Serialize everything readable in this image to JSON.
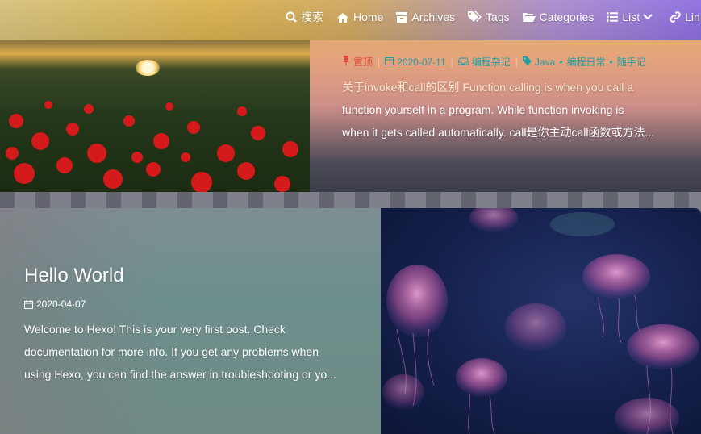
{
  "nav": {
    "items": [
      {
        "label": "搜索",
        "icon": "search-icon"
      },
      {
        "label": "Home",
        "icon": "home-icon"
      },
      {
        "label": "Archives",
        "icon": "archive-icon"
      },
      {
        "label": "Tags",
        "icon": "tags-icon"
      },
      {
        "label": "Categories",
        "icon": "folder-open-icon"
      },
      {
        "label": "List",
        "icon": "list-icon"
      },
      {
        "label": "Lin",
        "icon": "link-icon"
      }
    ]
  },
  "featured_post": {
    "sticky_label": "置顶",
    "date": "2020-07-11",
    "category": "编程杂记",
    "tags": [
      "Java",
      "编程日常",
      "随手记"
    ],
    "excerpt_lines": [
      "关于invoke和call的区别 Function calling is when you call a",
      "function yourself in a program. While function invoking is",
      "when it gets called automatically. call是你主动call函数或方法..."
    ]
  },
  "second_post": {
    "title": "Hello World",
    "date": "2020-04-07",
    "excerpt_lines": [
      "Welcome to Hexo! This is your very first post. Check",
      "documentation for more info. If you get any problems when",
      "using Hexo, you can find the answer in troubleshooting or yo..."
    ]
  },
  "colors": {
    "sticky": "#e2463c",
    "meta_accent": "#1e9fa8"
  }
}
